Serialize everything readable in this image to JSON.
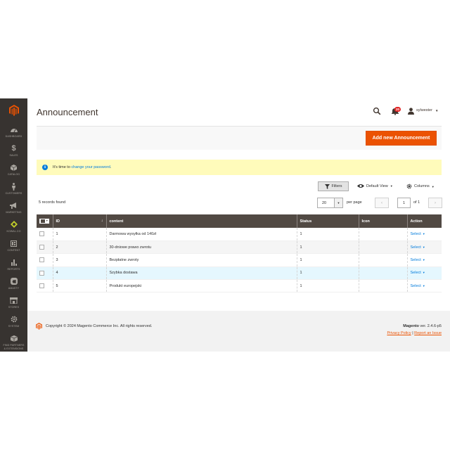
{
  "sidebar": {
    "items": [
      {
        "label": "DASHBOARD",
        "icon": "dashboard-icon"
      },
      {
        "label": "SALES",
        "icon": "dollar-icon"
      },
      {
        "label": "CATALOG",
        "icon": "cube-icon"
      },
      {
        "label": "CUSTOMERS",
        "icon": "person-icon"
      },
      {
        "label": "MARKETING",
        "icon": "megaphone-icon"
      },
      {
        "label": "KOWAL.CO",
        "icon": "diamond-icon"
      },
      {
        "label": "CONTENT",
        "icon": "layout-icon"
      },
      {
        "label": "REPORTS",
        "icon": "bar-chart-icon"
      },
      {
        "label": "AMASTY",
        "icon": "amasty-icon"
      },
      {
        "label": "STORES",
        "icon": "store-icon"
      },
      {
        "label": "SYSTEM",
        "icon": "gear-icon"
      },
      {
        "label": "FIND PARTNERS",
        "label2": "& EXTENSIONS",
        "icon": "box-icon"
      }
    ]
  },
  "header": {
    "title": "Announcement",
    "notifications_count": "20",
    "username": "sylwester"
  },
  "actions": {
    "add_label": "Add new Announcement"
  },
  "message": {
    "text": "It's time to ",
    "link": "change your password",
    "end": "."
  },
  "toolbar": {
    "filters_label": "Filters",
    "view_label": "Default View",
    "columns_label": "Columns",
    "records_found": "5 records found",
    "per_page_value": "20",
    "per_page_label": "per page",
    "current_page": "1",
    "of_pages": "of 1"
  },
  "grid": {
    "columns": [
      "ID",
      "content",
      "Status",
      "Icon",
      "Action"
    ],
    "rows": [
      {
        "id": "1",
        "content": "Darmowa wysyłka od 140zł",
        "status": "1",
        "icon": "",
        "action": "Select"
      },
      {
        "id": "2",
        "content": "30-dniowe prawo zwrotu",
        "status": "1",
        "icon": "",
        "action": "Select"
      },
      {
        "id": "3",
        "content": "Bezpłatne zwroty",
        "status": "1",
        "icon": "",
        "action": "Select"
      },
      {
        "id": "4",
        "content": "Szybka dostawa",
        "status": "1",
        "icon": "",
        "action": "Select"
      },
      {
        "id": "5",
        "content": "Produkt europejski",
        "status": "1",
        "icon": "",
        "action": "Select"
      }
    ]
  },
  "footer": {
    "copyright": "Copyright © 2024 Magento Commerce Inc. All rights reserved.",
    "brand": "Magento",
    "version": " ver. 2.4.6-p5",
    "privacy_link": "Privacy Policy",
    "separator": " | ",
    "report_link": "Report an Issue"
  },
  "colors": {
    "sidebar_bg": "#373330",
    "accent": "#eb5202",
    "table_header": "#514943",
    "link": "#007bdb",
    "message_bg": "#fffbbb"
  }
}
